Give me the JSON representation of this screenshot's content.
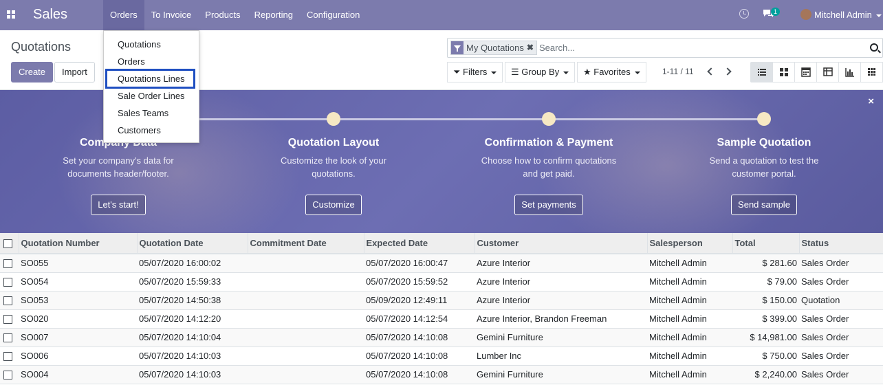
{
  "app": {
    "brand": "Sales"
  },
  "menu": [
    "Orders",
    "To Invoice",
    "Products",
    "Reporting",
    "Configuration"
  ],
  "systray": {
    "message_count": "1",
    "user_name": "Mitchell Admin"
  },
  "dropdown": [
    "Quotations",
    "Orders",
    "Quotations Lines",
    "Sale Order Lines",
    "Sales Teams",
    "Customers"
  ],
  "control": {
    "breadcrumb": "Quotations",
    "create_label": "Create",
    "import_label": "Import",
    "facet": "My Quotations",
    "search_placeholder": "Search...",
    "filters": "Filters",
    "group_by": "Group By",
    "favorites": "Favorites",
    "pager": "1-11 / 11"
  },
  "banner": {
    "steps": [
      {
        "title": "Company Data",
        "desc1": "Set your company's data for",
        "desc2": "documents header/footer.",
        "button": "Let's start!"
      },
      {
        "title": "Quotation Layout",
        "desc1": "Customize the look of your",
        "desc2": "quotations.",
        "button": "Customize"
      },
      {
        "title": "Confirmation & Payment",
        "desc1": "Choose how to confirm quotations",
        "desc2": "and get paid.",
        "button": "Set payments"
      },
      {
        "title": "Sample Quotation",
        "desc1": "Send a quotation to test the",
        "desc2": "customer portal.",
        "button": "Send sample"
      }
    ],
    "close": "×"
  },
  "table": {
    "headers": [
      "Quotation Number",
      "Quotation Date",
      "Commitment Date",
      "Expected Date",
      "Customer",
      "Salesperson",
      "Total",
      "Status"
    ],
    "rows": [
      [
        "SO055",
        "05/07/2020 16:00:02",
        "",
        "05/07/2020 16:00:47",
        "Azure Interior",
        "Mitchell Admin",
        "$ 281.60",
        "Sales Order"
      ],
      [
        "SO054",
        "05/07/2020 15:59:33",
        "",
        "05/07/2020 15:59:52",
        "Azure Interior",
        "Mitchell Admin",
        "$ 79.00",
        "Sales Order"
      ],
      [
        "SO053",
        "05/07/2020 14:50:38",
        "",
        "05/09/2020 12:49:11",
        "Azure Interior",
        "Mitchell Admin",
        "$ 150.00",
        "Quotation"
      ],
      [
        "SO020",
        "05/07/2020 14:12:20",
        "",
        "05/07/2020 14:12:54",
        "Azure Interior, Brandon Freeman",
        "Mitchell Admin",
        "$ 399.00",
        "Sales Order"
      ],
      [
        "SO007",
        "05/07/2020 14:10:04",
        "",
        "05/07/2020 14:10:08",
        "Gemini Furniture",
        "Mitchell Admin",
        "$ 14,981.00",
        "Sales Order"
      ],
      [
        "SO006",
        "05/07/2020 14:10:03",
        "",
        "05/07/2020 14:10:08",
        "Lumber Inc",
        "Mitchell Admin",
        "$ 750.00",
        "Sales Order"
      ],
      [
        "SO004",
        "05/07/2020 14:10:03",
        "",
        "05/07/2020 14:10:08",
        "Gemini Furniture",
        "Mitchell Admin",
        "$ 2,240.00",
        "Sales Order"
      ]
    ]
  }
}
